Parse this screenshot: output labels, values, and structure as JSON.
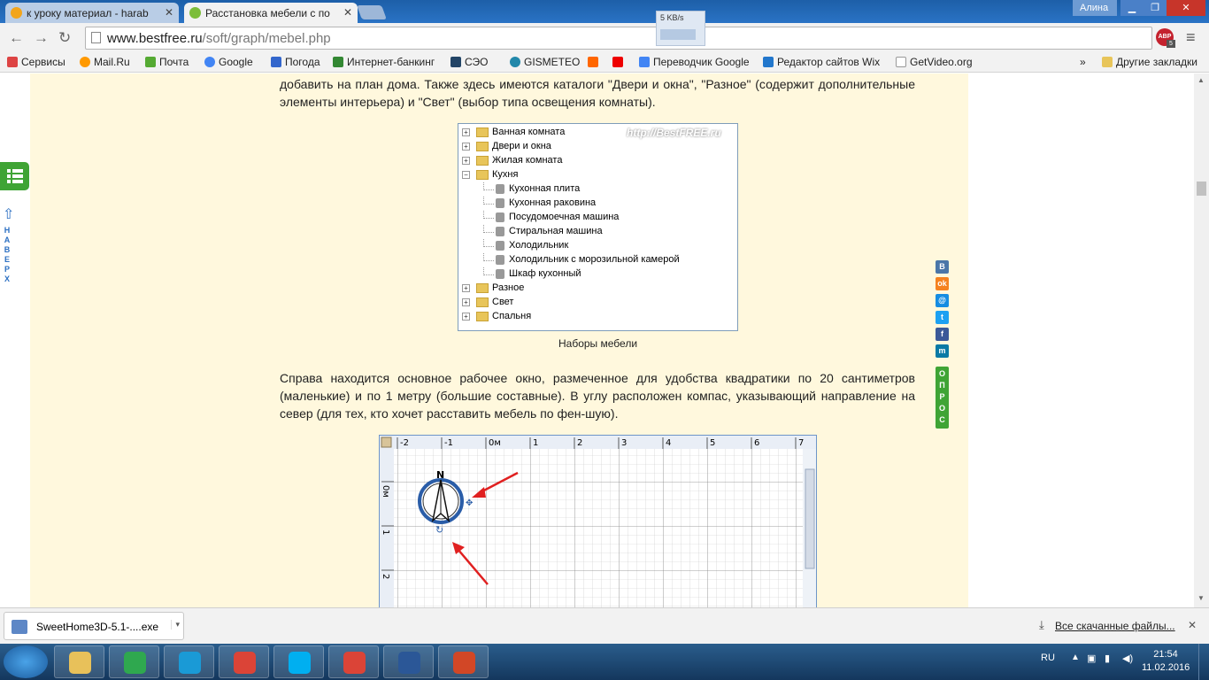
{
  "browser": {
    "tabs": [
      {
        "label": "к уроку материал - harab",
        "color": "#f2a51c"
      },
      {
        "label": "Расстановка мебели с по",
        "color": "#7cbd3a"
      }
    ],
    "user": "Алина",
    "speed_widget": "5 KB/s",
    "url_host": "www.bestfree.ru",
    "url_path": "/soft/graph/mebel.php",
    "abp_badge": "ABP",
    "abp_count": "5"
  },
  "bookmarks": [
    {
      "label": "Сервисы",
      "color": "#d44"
    },
    {
      "label": "Mail.Ru",
      "color": "#f90"
    },
    {
      "label": "Почта",
      "color": "#5a3"
    },
    {
      "label": "Google",
      "color": "#4285f4"
    },
    {
      "label": "Погода",
      "color": "#36c"
    },
    {
      "label": "Интернет-банкинг",
      "color": "#383"
    },
    {
      "label": "СЭО",
      "color": "#246"
    },
    {
      "label": "GISMETEO",
      "color": "#28a"
    },
    {
      "label": "",
      "color": "#f60"
    },
    {
      "label": "",
      "color": "#e00"
    },
    {
      "label": "Переводчик Google",
      "color": "#4285f4"
    },
    {
      "label": "Редактор сайтов Wix",
      "color": "#27c"
    },
    {
      "label": "GetVideo.org",
      "color": "#999"
    }
  ],
  "bookmarks_more": "»",
  "bookmarks_other": "Другие закладки",
  "article": {
    "para1": "добавить на план дома. Также здесь имеются каталоги \"Двери и окна\", \"Разное\" (содержит дополнительные элементы интерьера) и \"Свет\" (выбор типа освещения комнаты).",
    "tree_watermark": "http://BestFREE.ru",
    "tree": [
      {
        "label": "Ванная комната",
        "kind": "folder",
        "expanded": false
      },
      {
        "label": "Двери и окна",
        "kind": "folder",
        "expanded": false
      },
      {
        "label": "Жилая комната",
        "kind": "folder",
        "expanded": false
      },
      {
        "label": "Кухня",
        "kind": "folder",
        "expanded": true
      },
      {
        "label": "Кухонная плита",
        "kind": "item"
      },
      {
        "label": "Кухонная раковина",
        "kind": "item"
      },
      {
        "label": "Посудомоечная машина",
        "kind": "item"
      },
      {
        "label": "Стиральная машина",
        "kind": "item"
      },
      {
        "label": "Холодильник",
        "kind": "item"
      },
      {
        "label": "Холодильник с морозильной камерой",
        "kind": "item"
      },
      {
        "label": "Шкаф кухонный",
        "kind": "item"
      },
      {
        "label": "Разное",
        "kind": "folder",
        "expanded": false
      },
      {
        "label": "Свет",
        "kind": "folder",
        "expanded": false
      },
      {
        "label": "Спальня",
        "kind": "folder",
        "expanded": false
      }
    ],
    "tree_caption": "Наборы мебели",
    "para2": "Справа находится основное рабочее окно, размеченное для удобства квадратики по 20 сантиметров (маленькие) и по 1 метру (большие составные). В углу расположен компас, указывающий направление на север (для тех, кто хочет расставить мебель по фен-шую).",
    "plan": {
      "ruler_x": [
        "-2",
        "-1",
        "0м",
        "1",
        "2",
        "3",
        "4",
        "5",
        "6",
        "7"
      ],
      "ruler_y": [
        "0м",
        "1",
        "2"
      ],
      "compass_label": "N"
    }
  },
  "social": [
    {
      "label": "В",
      "color": "#4a76a8"
    },
    {
      "label": "ok",
      "color": "#f58220"
    },
    {
      "label": "@",
      "color": "#168de2"
    },
    {
      "label": "t",
      "color": "#1da1f2"
    },
    {
      "label": "f",
      "color": "#3b5998"
    },
    {
      "label": "m",
      "color": "#0a7aa5"
    }
  ],
  "opros": [
    "О",
    "П",
    "Р",
    "О",
    "С"
  ],
  "naverh": [
    "Н",
    "А",
    "В",
    "Е",
    "Р",
    "Х"
  ],
  "download": {
    "file": "SweetHome3D-5.1-....exe",
    "all": "Все скачанные файлы..."
  },
  "taskbar": {
    "apps": [
      {
        "color": "#e8c15a"
      },
      {
        "color": "#2fa84f"
      },
      {
        "color": "#1a9ad6"
      },
      {
        "color": "#db4437"
      },
      {
        "color": "#00aff0"
      },
      {
        "color": "#db4437"
      },
      {
        "color": "#2b5797"
      },
      {
        "color": "#d24726"
      }
    ],
    "lang": "RU",
    "time": "21:54",
    "date": "11.02.2016"
  }
}
